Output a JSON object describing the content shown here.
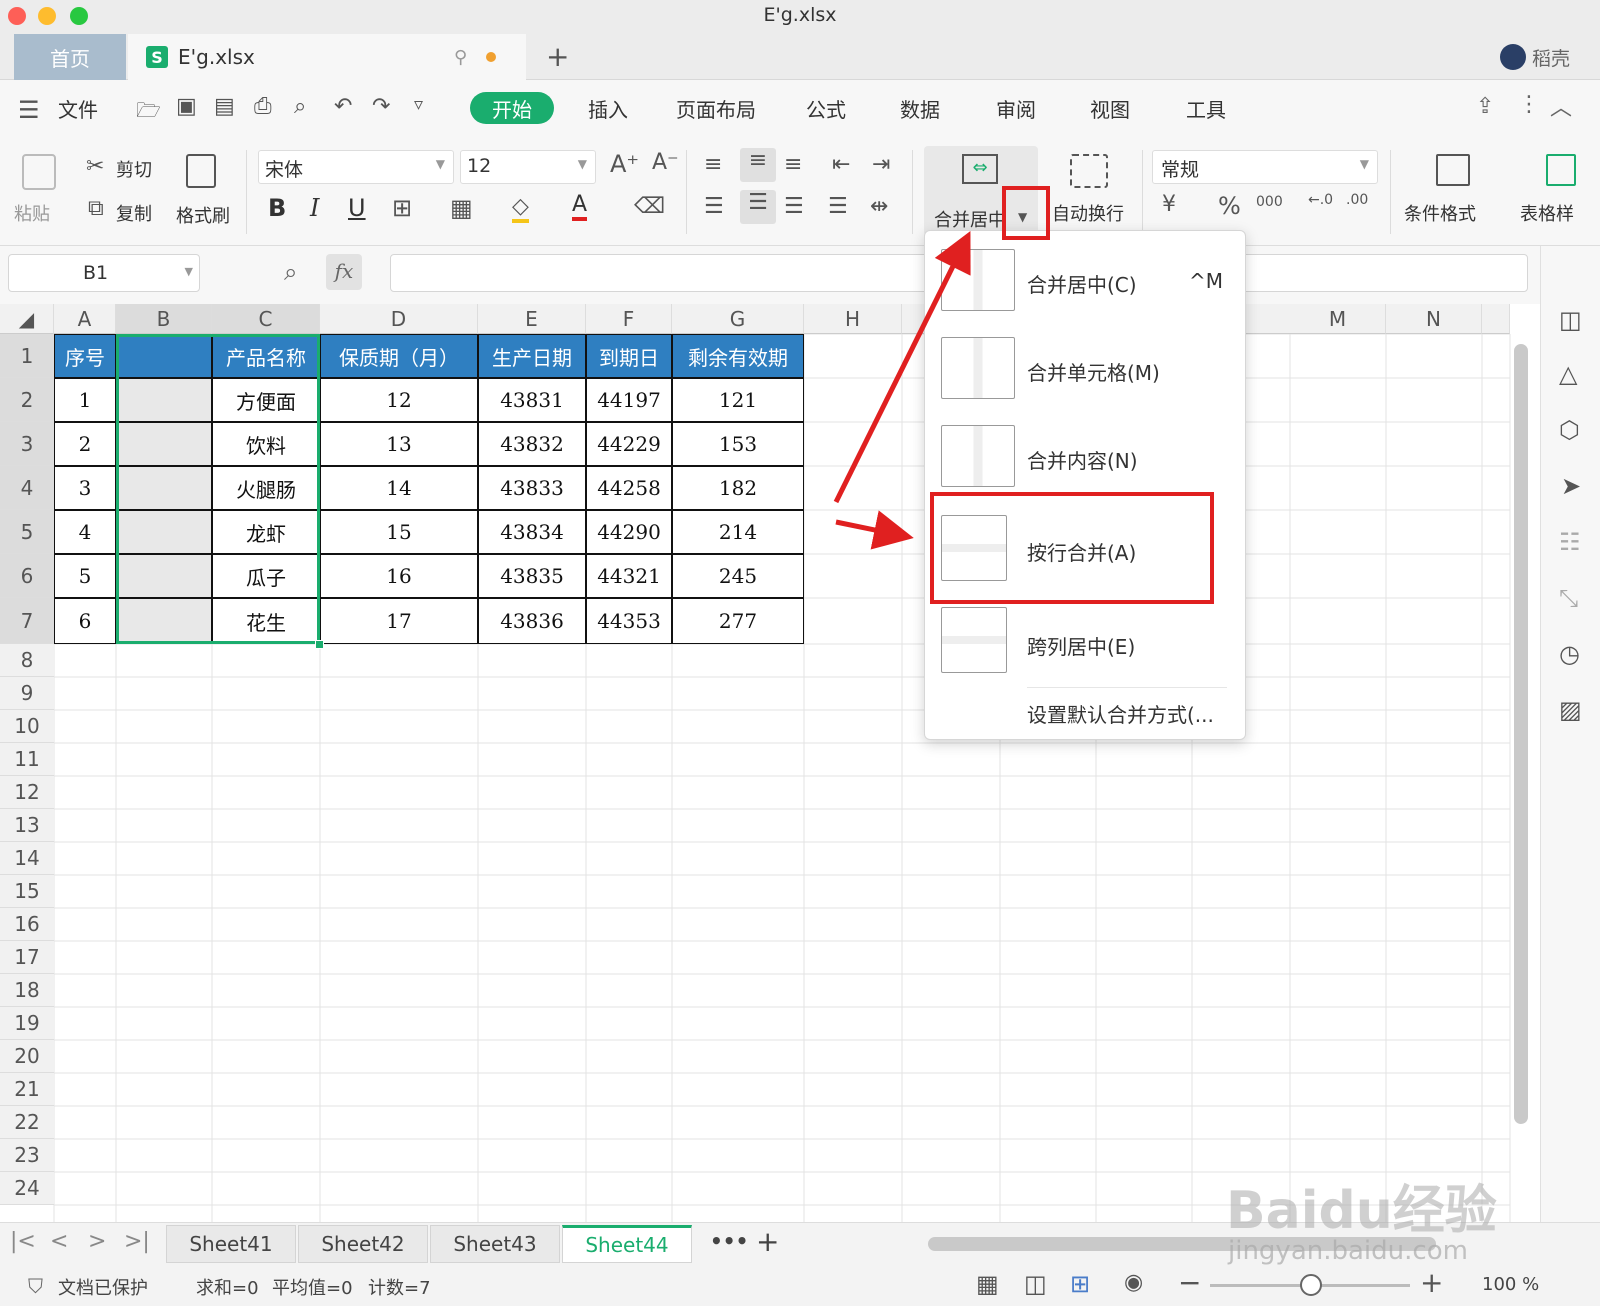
{
  "window": {
    "title": "E'g.xlsx"
  },
  "tabs": {
    "home": "首页",
    "file": "E'g.xlsx",
    "add": "+",
    "user": "稻壳"
  },
  "menu": {
    "file": "文件",
    "items": [
      "开始",
      "插入",
      "页面布局",
      "公式",
      "数据",
      "审阅",
      "视图",
      "工具"
    ]
  },
  "ribbon": {
    "paste": "粘贴",
    "cut": "剪切",
    "copy": "复制",
    "format_painter": "格式刷",
    "font_name": "宋体",
    "font_size": "12",
    "merge_center": "合并居中",
    "wrap": "自动换行",
    "number_format": "常规",
    "conditional_format": "条件格式",
    "table_style": "表格样"
  },
  "formula_bar": {
    "name_box": "B1",
    "fx": "fx",
    "value": ""
  },
  "grid": {
    "columns": [
      "A",
      "B",
      "C",
      "D",
      "E",
      "F",
      "G",
      "H",
      "M",
      "N"
    ],
    "rows": [
      "1",
      "2",
      "3",
      "4",
      "5",
      "6",
      "7",
      "8",
      "9",
      "10",
      "11",
      "12",
      "13",
      "14",
      "15",
      "16",
      "17",
      "18",
      "19",
      "20",
      "21",
      "22",
      "23",
      "24"
    ],
    "header": [
      "序号",
      "",
      "产品名称",
      "保质期（月）",
      "生产日期",
      "到期日",
      "剩余有效期"
    ],
    "data": [
      [
        "1",
        "",
        "方便面",
        "12",
        "43831",
        "44197",
        "121"
      ],
      [
        "2",
        "",
        "饮料",
        "13",
        "43832",
        "44229",
        "153"
      ],
      [
        "3",
        "",
        "火腿肠",
        "14",
        "43833",
        "44258",
        "182"
      ],
      [
        "4",
        "",
        "龙虾",
        "15",
        "43834",
        "44290",
        "214"
      ],
      [
        "5",
        "",
        "瓜子",
        "16",
        "43835",
        "44321",
        "245"
      ],
      [
        "6",
        "",
        "花生",
        "17",
        "43836",
        "44353",
        "277"
      ]
    ]
  },
  "dropdown": {
    "items": [
      {
        "label": "合并居中(C)",
        "shortcut": "^M"
      },
      {
        "label": "合并单元格(M)",
        "shortcut": ""
      },
      {
        "label": "合并内容(N)",
        "shortcut": ""
      },
      {
        "label": "按行合并(A)",
        "shortcut": ""
      },
      {
        "label": "跨列居中(E)",
        "shortcut": ""
      },
      {
        "label": "设置默认合并方式(...",
        "shortcut": ""
      }
    ]
  },
  "sheets": {
    "tabs": [
      "Sheet41",
      "Sheet42",
      "Sheet43",
      "Sheet44"
    ],
    "active": "Sheet44",
    "more": "•••",
    "add": "+"
  },
  "status": {
    "protect": "文档已保护",
    "sum": "求和=0",
    "avg": "平均值=0",
    "count": "计数=7",
    "zoom": "100 %"
  },
  "watermark": {
    "brand": "Baidu经验",
    "url": "jingyan.baidu.com"
  },
  "colors": {
    "accent": "#1aad6e",
    "header_fill": "#2f7fc1",
    "highlight": "#e02020",
    "selection": "#1aad6e"
  }
}
